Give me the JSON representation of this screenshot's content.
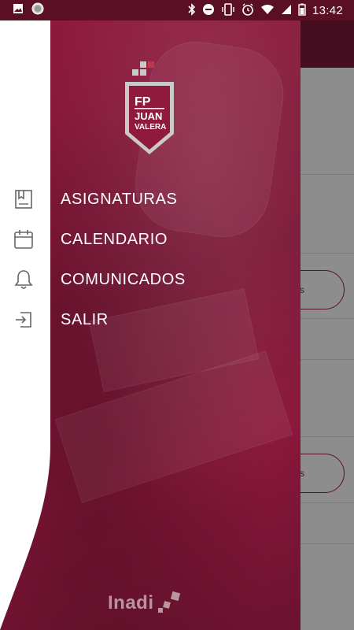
{
  "status_bar": {
    "time": "13:42",
    "icons": [
      "image-icon",
      "circle-icon",
      "bluetooth-icon",
      "do-not-disturb-icon",
      "vibrate-icon",
      "alarm-icon",
      "wifi-icon",
      "signal-icon",
      "battery-icon"
    ]
  },
  "logo": {
    "line1": "FP",
    "line2": "JUAN",
    "line3": "VALERA"
  },
  "menu": {
    "items": [
      {
        "label": "ASIGNATURAS",
        "icon": "book-icon"
      },
      {
        "label": "CALENDARIO",
        "icon": "calendar-icon"
      },
      {
        "label": "COMUNICADOS",
        "icon": "bell-icon"
      },
      {
        "label": "SALIR",
        "icon": "logout-icon"
      }
    ]
  },
  "footer": {
    "brand": "Inadi"
  },
  "behind": {
    "pill_1": "s",
    "pill_2": "s"
  },
  "colors": {
    "primary": "#8f1a3e",
    "status_bar": "#5a0f24",
    "icon_gray": "#666666"
  }
}
